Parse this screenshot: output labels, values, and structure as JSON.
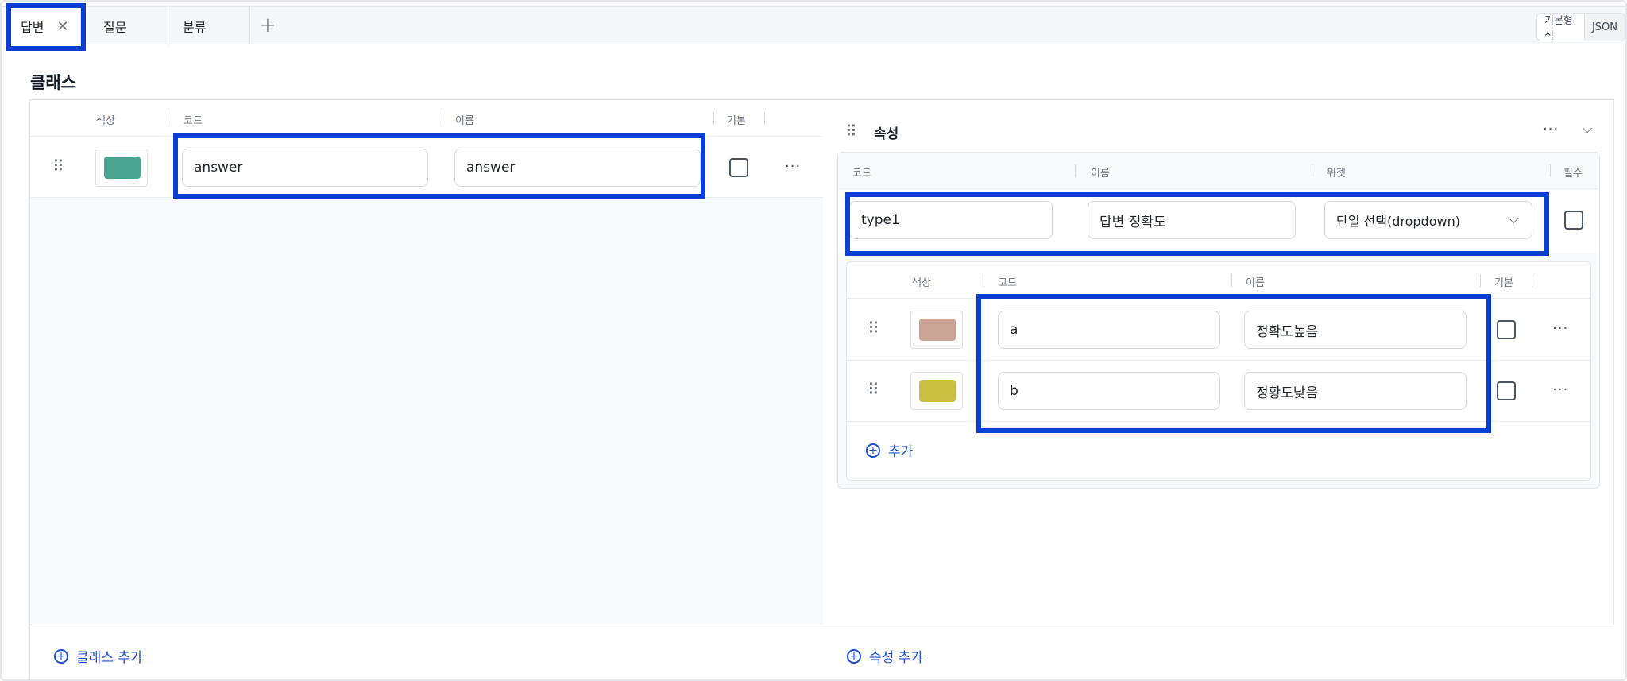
{
  "tabs": [
    {
      "label": "답변",
      "active": true
    },
    {
      "label": "질문",
      "active": false
    },
    {
      "label": "분류",
      "active": false
    }
  ],
  "view_toggle": {
    "options": [
      "기본형식",
      "JSON"
    ],
    "selected": "기본형식"
  },
  "section_title": "클래스",
  "class_table": {
    "headers": {
      "color": "색상",
      "code": "코드",
      "name": "이름",
      "default": "기본"
    },
    "rows": [
      {
        "color": "#4aa590",
        "code": "answer",
        "name": "answer",
        "default": false
      }
    ],
    "add_label": "클래스 추가"
  },
  "attribute_panel": {
    "title": "속성",
    "headers": {
      "code": "코드",
      "name": "이름",
      "widget": "위젯",
      "required": "필수"
    },
    "attribute": {
      "code": "type1",
      "name": "답변 정확도",
      "widget": "단일 선택(dropdown)",
      "required": false
    },
    "options_table": {
      "headers": {
        "color": "색상",
        "code": "코드",
        "name": "이름",
        "default": "기본"
      },
      "rows": [
        {
          "color": "#c9a393",
          "code": "a",
          "name": "정확도높음",
          "default": false
        },
        {
          "color": "#c9c043",
          "code": "b",
          "name": "정황도낮음",
          "default": false
        }
      ],
      "add_label": "추가"
    },
    "add_label": "속성 추가"
  },
  "icons": [
    "close-icon",
    "plus-icon",
    "drag-handle-icon",
    "more-icon",
    "chevron-down-icon",
    "plus-circle-icon"
  ],
  "colors": {
    "accent": "#1d4ed8",
    "highlight": "#0b3fd4"
  }
}
